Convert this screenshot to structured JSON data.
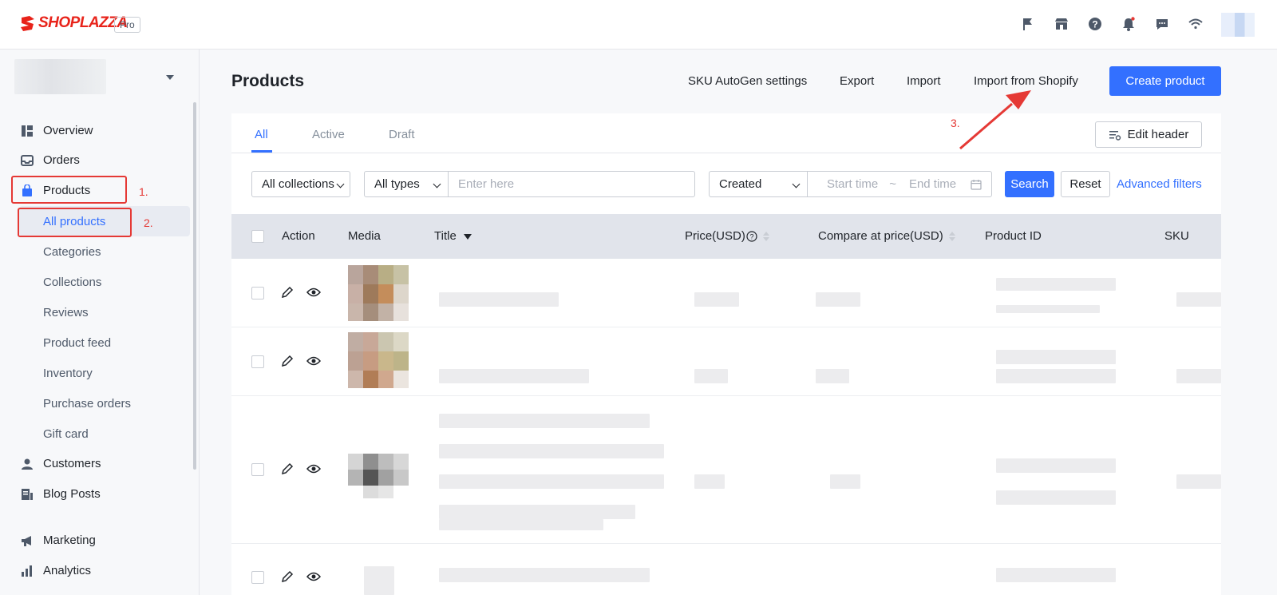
{
  "brand": {
    "name": "SHOPLAZZA",
    "badge": "Pro"
  },
  "topbar": {
    "icons": [
      "flag-icon",
      "store-icon",
      "help-icon",
      "bell-icon",
      "chat-icon",
      "wifi-icon"
    ]
  },
  "sidebar": {
    "items": [
      {
        "label": "Overview",
        "icon": "overview-icon"
      },
      {
        "label": "Orders",
        "icon": "orders-icon"
      },
      {
        "label": "Products",
        "icon": "products-icon"
      },
      {
        "label": "Customers",
        "icon": "customers-icon"
      },
      {
        "label": "Blog Posts",
        "icon": "blog-icon"
      },
      {
        "label": "Marketing",
        "icon": "marketing-icon"
      },
      {
        "label": "Analytics",
        "icon": "analytics-icon"
      }
    ],
    "sub_items": [
      "All products",
      "Categories",
      "Collections",
      "Reviews",
      "Product feed",
      "Inventory",
      "Purchase orders",
      "Gift card"
    ]
  },
  "annotations": {
    "step1": "1.",
    "step2": "2.",
    "step3": "3."
  },
  "header": {
    "title": "Products",
    "links": [
      "SKU AutoGen settings",
      "Export",
      "Import",
      "Import from Shopify"
    ],
    "create_label": "Create product"
  },
  "tabs": [
    "All",
    "Active",
    "Draft"
  ],
  "edit_header_label": "Edit header",
  "filters": {
    "collection": "All collections",
    "type": "All types",
    "keyword_placeholder": "Enter here",
    "date_field": "Created",
    "start_placeholder": "Start time",
    "range_sep": "~",
    "end_placeholder": "End time",
    "search_label": "Search",
    "reset_label": "Reset",
    "advanced_label": "Advanced filters"
  },
  "table": {
    "columns": [
      "Action",
      "Media",
      "Title",
      "Price(USD)",
      "Compare at price(USD)",
      "Product ID",
      "SKU"
    ]
  },
  "colors": {
    "accent": "#3370ff",
    "brand": "#e8231a",
    "annotation": "#e53935"
  }
}
